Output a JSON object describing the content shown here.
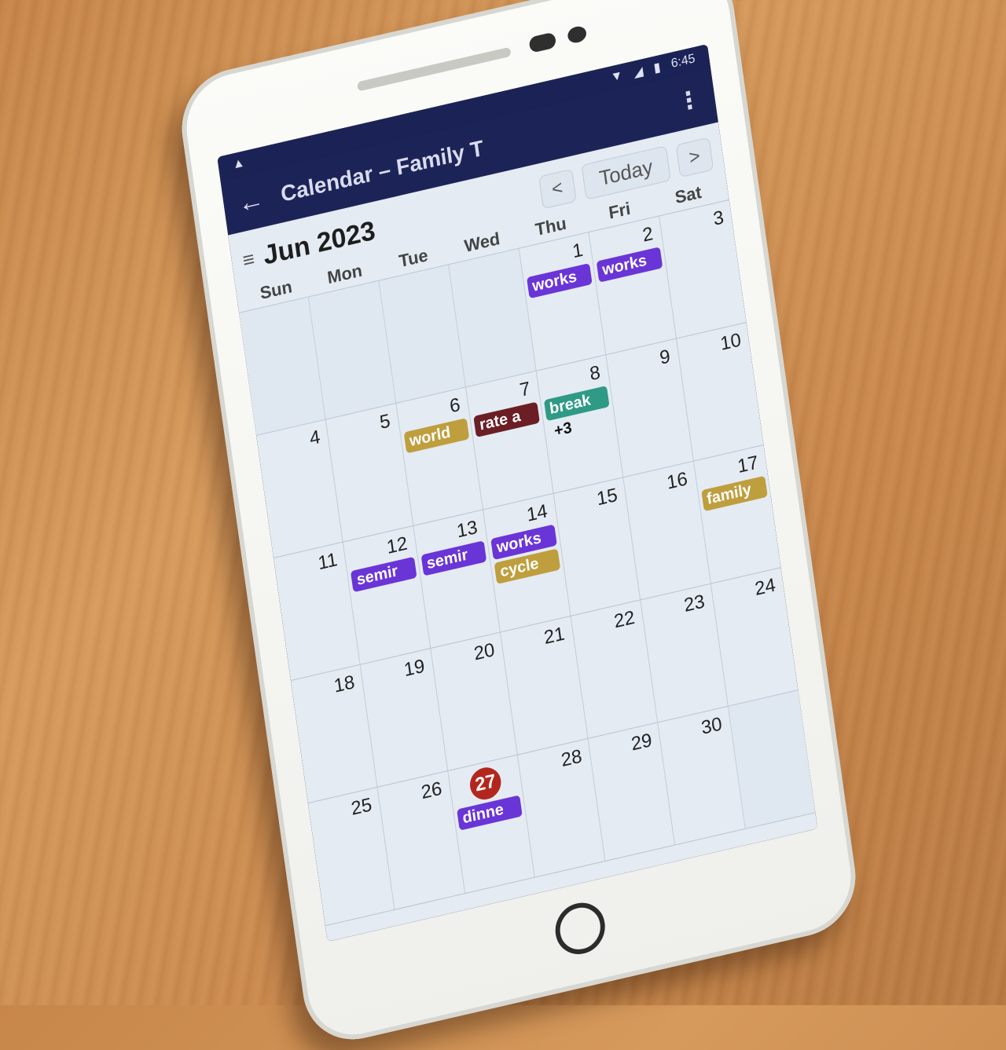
{
  "status": {
    "time": "6:45"
  },
  "appbar": {
    "title": "Calendar – Family T"
  },
  "calendar": {
    "month": "Jun 2023",
    "prev": "<",
    "today": "Today",
    "next": ">",
    "weekdays": [
      "Sun",
      "Mon",
      "Tue",
      "Wed",
      "Thu",
      "Fri",
      "Sat"
    ],
    "colors": {
      "purple": "#6a35d6",
      "maroon": "#6b1e24",
      "teal": "#2f9a86",
      "gold": "#bf9e3e",
      "today": "#b3261e"
    },
    "weeks": [
      [
        {
          "n": "",
          "events": []
        },
        {
          "n": "",
          "events": []
        },
        {
          "n": "",
          "events": []
        },
        {
          "n": "",
          "events": []
        },
        {
          "n": "1",
          "events": [
            {
              "t": "works",
              "c": "purple"
            }
          ]
        },
        {
          "n": "2",
          "events": [
            {
              "t": "works",
              "c": "purple"
            }
          ]
        },
        {
          "n": "3",
          "events": []
        }
      ],
      [
        {
          "n": "4",
          "events": []
        },
        {
          "n": "5",
          "events": []
        },
        {
          "n": "6",
          "events": [
            {
              "t": "world",
              "c": "gold"
            }
          ]
        },
        {
          "n": "7",
          "events": [
            {
              "t": "rate a",
              "c": "maroon"
            }
          ]
        },
        {
          "n": "8",
          "events": [
            {
              "t": "break",
              "c": "teal"
            }
          ],
          "more": "+3"
        },
        {
          "n": "9",
          "events": []
        },
        {
          "n": "10",
          "events": []
        }
      ],
      [
        {
          "n": "11",
          "events": []
        },
        {
          "n": "12",
          "events": [
            {
              "t": "semir",
              "c": "purple"
            }
          ]
        },
        {
          "n": "13",
          "events": [
            {
              "t": "semir",
              "c": "purple"
            }
          ]
        },
        {
          "n": "14",
          "events": [
            {
              "t": "works",
              "c": "purple"
            },
            {
              "t": "cycle",
              "c": "gold"
            }
          ]
        },
        {
          "n": "15",
          "events": []
        },
        {
          "n": "16",
          "events": []
        },
        {
          "n": "17",
          "events": [
            {
              "t": "family",
              "c": "gold"
            }
          ]
        }
      ],
      [
        {
          "n": "18",
          "events": []
        },
        {
          "n": "19",
          "events": []
        },
        {
          "n": "20",
          "events": []
        },
        {
          "n": "21",
          "events": []
        },
        {
          "n": "22",
          "events": []
        },
        {
          "n": "23",
          "events": []
        },
        {
          "n": "24",
          "events": []
        }
      ],
      [
        {
          "n": "25",
          "events": []
        },
        {
          "n": "26",
          "events": []
        },
        {
          "n": "27",
          "events": [
            {
              "t": "dinne",
              "c": "purple"
            }
          ],
          "today": true
        },
        {
          "n": "28",
          "events": []
        },
        {
          "n": "29",
          "events": []
        },
        {
          "n": "30",
          "events": []
        },
        {
          "n": "",
          "events": []
        }
      ]
    ]
  }
}
